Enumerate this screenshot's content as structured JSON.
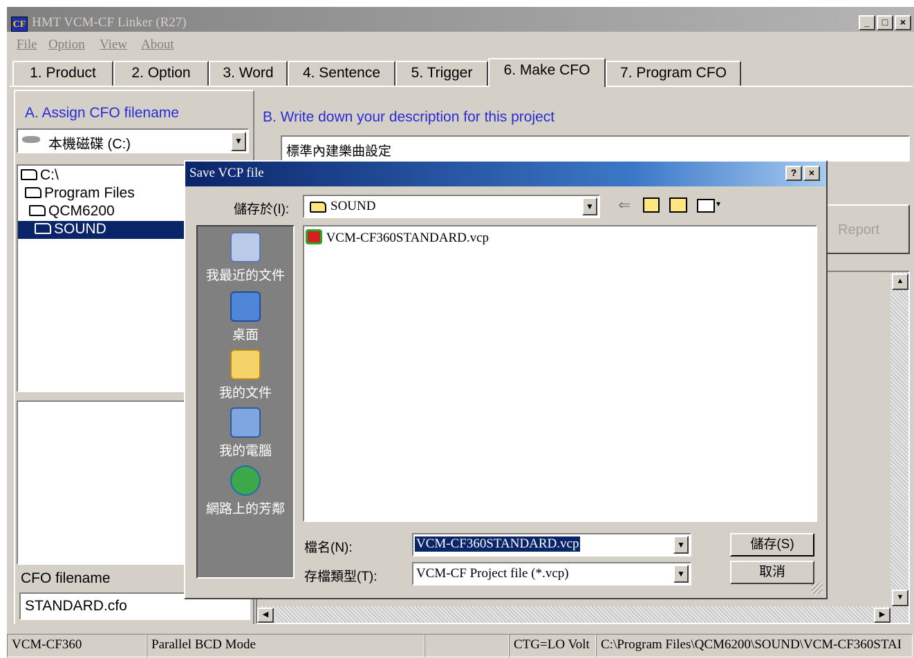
{
  "window": {
    "title": "HMT VCM-CF Linker (R27)",
    "icon_text": "CF",
    "minimize": "_",
    "maximize": "□",
    "close": "×"
  },
  "menu": [
    "File",
    "Option",
    "View",
    "About"
  ],
  "tabs": [
    "1. Product",
    "2. Option",
    "3. Word",
    "4. Sentence",
    "5. Trigger",
    "6. Make CFO",
    "7. Program CFO"
  ],
  "active_tab": "6. Make CFO",
  "section_a": {
    "label": "A. Assign CFO filename",
    "drive": "本機磁碟 (C:)",
    "tree": [
      "C:\\",
      "Program Files",
      "QCM6200",
      "SOUND"
    ],
    "cfo_label": "CFO filename",
    "cfo_value": "STANDARD.cfo"
  },
  "section_b": {
    "label": "B. Write down your description for this project",
    "description": "標準內建樂曲設定",
    "report_button": "Report"
  },
  "dialog": {
    "title": "Save VCP file",
    "help": "?",
    "close": "×",
    "save_in_label": "儲存於(I):",
    "save_in_value": "SOUND",
    "places": [
      "我最近的文件",
      "桌面",
      "我的文件",
      "我的電腦",
      "網路上的芳鄰"
    ],
    "files": [
      "VCM-CF360STANDARD.vcp"
    ],
    "filename_label": "檔名(N):",
    "filename_value": "VCM-CF360STANDARD.vcp",
    "filetype_label": "存檔類型(T):",
    "filetype_value": "VCM-CF Project file (*.vcp)",
    "save_button": "儲存(S)",
    "cancel_button": "取消"
  },
  "status": {
    "model": "VCM-CF360",
    "mode": "Parallel BCD Mode",
    "empty": "",
    "ctg": "CTG=LO Volt",
    "path": "C:\\Program Files\\QCM6200\\SOUND\\VCM-CF360STAI"
  }
}
